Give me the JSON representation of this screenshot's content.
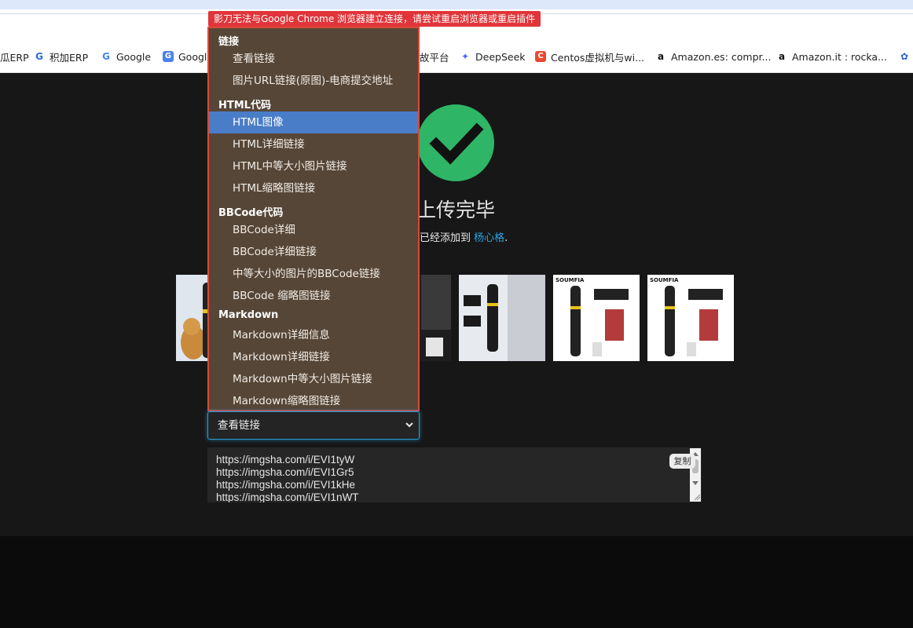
{
  "bookmarks": [
    {
      "label": "瓜ERP",
      "icon": "erp-icon"
    },
    {
      "label": "积加ERP",
      "icon": "jijia-icon"
    },
    {
      "label": "Google",
      "icon": "google-icon"
    },
    {
      "label": "Googl",
      "icon": "google-translate-icon"
    },
    {
      "label": "故平台",
      "icon": "platform-icon"
    },
    {
      "label": "DeepSeek",
      "icon": "deepseek-icon"
    },
    {
      "label": "Centos虚拟机与wi...",
      "icon": "centos-icon"
    },
    {
      "label": "Amazon.es: compr...",
      "icon": "amazon-icon"
    },
    {
      "label": "Amazon.it : rocka...",
      "icon": "amazon-icon"
    }
  ],
  "extension_tooltip": "影刀无法与Google Chrome 浏览器建立连接，请尝试重启浏览器或重启插件",
  "upload": {
    "title": "上传完毕",
    "added_prefix": "已经添加到",
    "album_link": "杨心格",
    "added_suffix": "."
  },
  "dropdown": {
    "groups": [
      {
        "label": "链接",
        "options": [
          "查看链接",
          "图片URL链接(原图)-电商提交地址"
        ]
      },
      {
        "label": "HTML代码",
        "options": [
          "HTML图像",
          "HTML详细链接",
          "HTML中等大小图片链接",
          "HTML缩略图链接"
        ]
      },
      {
        "label": "BBCode代码",
        "options": [
          "BBCode详细",
          "BBCode详细链接",
          "中等大小的图片的BBCode链接",
          "BBCode 缩略图链接"
        ]
      },
      {
        "label": "Markdown",
        "options": [
          "Markdown详细信息",
          "Markdown详细链接",
          "Markdown中等大小图片链接",
          "Markdown缩略图链接"
        ]
      }
    ],
    "highlighted": "HTML图像",
    "selected_value": "查看链接"
  },
  "thumbnails": [
    {
      "brand": ""
    },
    {
      "brand": ""
    },
    {
      "brand": ""
    },
    {
      "brand": "SOUMFIA"
    },
    {
      "brand": "SOUMFIA"
    }
  ],
  "links_text": {
    "lines": [
      "https://imgsha.com/i/EVI1tyW",
      "https://imgsha.com/i/EVI1Gr5",
      "https://imgsha.com/i/EVI1kHe",
      "https://imgsha.com/i/EVI1nWT"
    ],
    "copy_label": "复制"
  },
  "colors": {
    "accent": "#2a9bd6",
    "success": "#2fb566",
    "dropdown_bg": "#564637",
    "highlight": "#4a7dc8",
    "tooltip_bg": "#e0353a"
  }
}
